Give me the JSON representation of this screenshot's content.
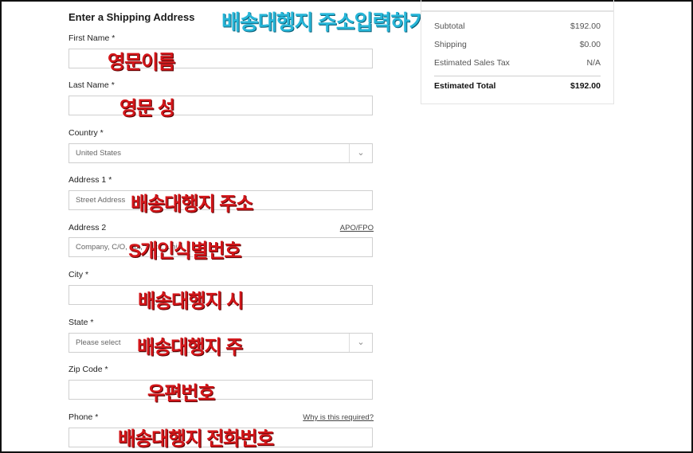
{
  "form": {
    "title": "Enter a Shipping Address",
    "banner": "배송대행지 주소입력하기",
    "first_name": {
      "label": "First Name *",
      "value": "",
      "overlay": "영문이름"
    },
    "last_name": {
      "label": "Last Name *",
      "value": "",
      "overlay": "영문 성"
    },
    "country": {
      "label": "Country *",
      "selected": "United States"
    },
    "address1": {
      "label": "Address 1 *",
      "placeholder": "Street Address",
      "overlay": "배송대행지 주소"
    },
    "address2": {
      "label": "Address 2",
      "link": "APO/FPO",
      "placeholder": "Company, C/O, Apt, Suite, Unit",
      "overlay": "S개인식별번호"
    },
    "city": {
      "label": "City *",
      "value": "",
      "overlay": "배송대행지 시"
    },
    "state": {
      "label": "State *",
      "selected": "Please select",
      "overlay": "배송대행지 주"
    },
    "zip": {
      "label": "Zip Code *",
      "value": "",
      "overlay": "우편번호"
    },
    "phone": {
      "label": "Phone *",
      "link": "Why is this required?",
      "value": "",
      "overlay": "배송대행지 전화번호"
    }
  },
  "summary": {
    "subtotal": {
      "label": "Subtotal",
      "value": "$192.00"
    },
    "shipping": {
      "label": "Shipping",
      "value": "$0.00"
    },
    "tax": {
      "label": "Estimated Sales Tax",
      "value": "N/A"
    },
    "total": {
      "label": "Estimated Total",
      "value": "$192.00"
    }
  },
  "icons": {
    "select_chevron": "chevron-down-icon"
  }
}
